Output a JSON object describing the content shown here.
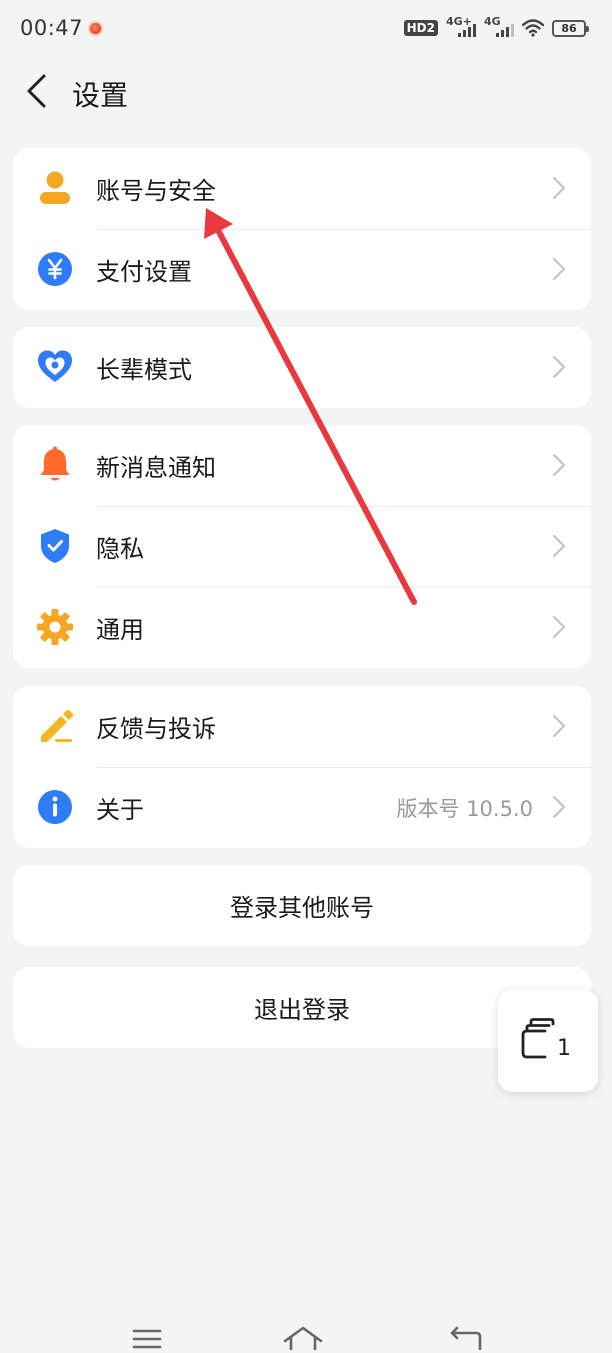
{
  "status_bar": {
    "time": "00:47",
    "hd_label": "HD2",
    "sim1_label": "4G+",
    "sim2_label": "4G",
    "battery": "86"
  },
  "header": {
    "title": "设置"
  },
  "groups": [
    {
      "items": [
        {
          "label": "账号与安全",
          "icon": "user-icon"
        },
        {
          "label": "支付设置",
          "icon": "yuan-icon"
        }
      ]
    },
    {
      "items": [
        {
          "label": "长辈模式",
          "icon": "heart-care-icon"
        }
      ]
    },
    {
      "items": [
        {
          "label": "新消息通知",
          "icon": "bell-icon"
        },
        {
          "label": "隐私",
          "icon": "shield-check-icon"
        },
        {
          "label": "通用",
          "icon": "gear-icon"
        }
      ]
    },
    {
      "items": [
        {
          "label": "反馈与投诉",
          "icon": "pencil-icon"
        },
        {
          "label": "关于",
          "icon": "info-icon",
          "value": "版本号 10.5.0"
        }
      ]
    }
  ],
  "actions": {
    "switch_account": "登录其他账号",
    "logout": "退出登录"
  },
  "floating_window": {
    "count": "1"
  },
  "colors": {
    "background": "#f4f4f4",
    "card": "#ffffff",
    "user_icon": "#f5a623",
    "yuan_icon": "#2f7cf6",
    "heart_icon": "#2f7cf6",
    "bell_icon": "#ff6a2b",
    "shield_icon": "#2f7cf6",
    "gear_icon": "#f5a623",
    "pencil_icon": "#f5b623",
    "info_icon": "#2f7cf6",
    "annotation_arrow": "#e8393f"
  }
}
